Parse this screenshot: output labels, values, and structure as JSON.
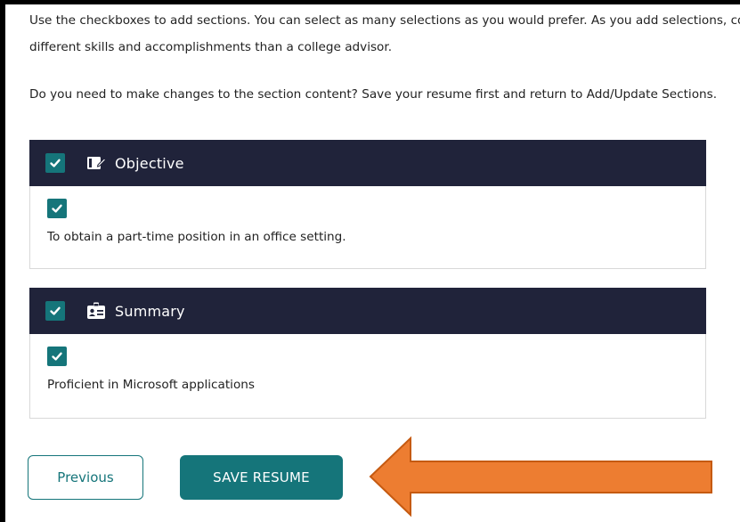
{
  "intro": {
    "line1": "Use the checkboxes to add sections. You can select as many selections as you would prefer. As you add selections, consider",
    "line2": "different skills and accomplishments than a college advisor.",
    "line3": "Do you need to make changes to the section content? Save your resume first and return to Add/Update Sections."
  },
  "sections": [
    {
      "title": "Objective",
      "icon": "notebook-edit-icon",
      "text": "To obtain a part-time position in an office setting.",
      "header_checked": true,
      "item_checked": true
    },
    {
      "title": "Summary",
      "icon": "id-card-icon",
      "text": "Proficient in Microsoft applications",
      "header_checked": true,
      "item_checked": true
    }
  ],
  "buttons": {
    "previous": "Previous",
    "save": "SAVE RESUME"
  },
  "colors": {
    "header_bg": "#20233a",
    "accent": "#15757a",
    "arrow": "#ed7d31"
  }
}
